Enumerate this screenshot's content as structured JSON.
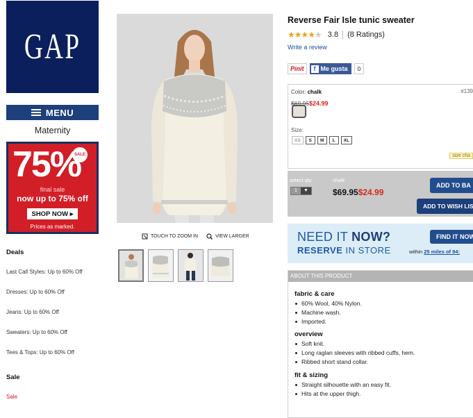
{
  "brand": {
    "logo_text": "GAP",
    "logo_bg": "#0b1f5c"
  },
  "nav": {
    "menu_label": "MENU",
    "category": "Maternity"
  },
  "promo": {
    "big": "75%",
    "badge": "SALE",
    "final": "final sale",
    "upto": "now up to 75% off",
    "shop": "SHOP NOW ▸",
    "marked": "Prices as marked.",
    "bg": "#d21f27"
  },
  "sidebar": {
    "deals_heading": "Deals",
    "deals": [
      "Last Call Styles: Up to 60% Off",
      "Dresses: Up to 60% Off",
      "Jeans: Up to 60% Off",
      "Sweaters: Up to 60% Off",
      "Tees & Tops: Up to 60% Off"
    ],
    "sale_heading": "Sale",
    "sale_link": "Sale"
  },
  "image_tools": {
    "zoom": "TOUCH TO ZOOM IN",
    "larger": "VIEW LARGER"
  },
  "product": {
    "title": "Reverse Fair Isle tunic sweater",
    "rating": "3.8",
    "rating_stars": 3.8,
    "ratings_count": "(8 Ratings)",
    "write_review": "Write a review",
    "pin_label": "Pinit",
    "fb_label": "Me gusta",
    "fb_count": "0",
    "color_label": "Color:",
    "color_value": "chalk",
    "sku": "#139",
    "price_old": "$69.95",
    "price_sale": "$24.99",
    "size_label": "Size:",
    "sizes": [
      "XS",
      "S",
      "M",
      "L",
      "XL"
    ],
    "size_chart": "size cha"
  },
  "buy": {
    "qty_label": "select qty",
    "qty_value": "1",
    "color": "chalk",
    "price_old": "$69.95",
    "price_sale": "$24.99",
    "add_bag": "ADD TO BA",
    "add_wish": "ADD TO WISH LIS"
  },
  "store": {
    "need": "NEED IT ",
    "now": "NOW?",
    "reserve": "RESERVE",
    "in_store": " IN STORE",
    "find": "FIND IT NOW",
    "within": "within ",
    "distance": "25 miles of 94:"
  },
  "about": {
    "heading": "ABOUT THIS PRODUCT",
    "sections": [
      {
        "title": "fabric & care",
        "items": [
          "60% Wool, 40% Nylon.",
          "Machine wash.",
          "Imported."
        ]
      },
      {
        "title": "overview",
        "items": [
          "Soft knit.",
          "Long raglan sleeves with ribbed cuffs, hem.",
          "Ribbed short stand collar."
        ]
      },
      {
        "title": "fit & sizing",
        "items": [
          "Straight silhouette with an easy fit.",
          "Hits at the upper thigh."
        ]
      }
    ]
  }
}
